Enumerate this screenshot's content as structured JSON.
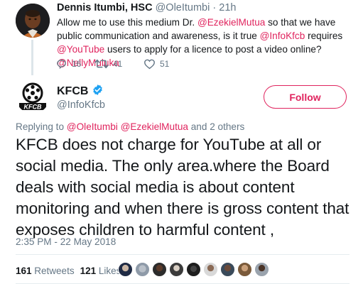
{
  "reply_tweet": {
    "author_name": "Dennis Itumbi, HSC",
    "author_handle": "@OleItumbi",
    "separator": "·",
    "time": "21h",
    "body_parts": [
      {
        "text": "Allow me to use this medium Dr. ",
        "link": false
      },
      {
        "text": "@EzekielMutua",
        "link": true
      },
      {
        "text": " so that we have public communication and awareness, is it true ",
        "link": false
      },
      {
        "text": "@InfoKfcb",
        "link": true
      },
      {
        "text": " requires ",
        "link": false
      },
      {
        "text": "@YouTube",
        "link": true
      },
      {
        "text": " users to apply for a licence to post a video online? ",
        "link": false
      },
      {
        "text": "@NellyMuluka",
        "link": true
      }
    ],
    "actions": {
      "reply_count": "16",
      "retweet_count": "41",
      "like_count": "51"
    }
  },
  "main_tweet": {
    "author_name": "KFCB",
    "author_handle": "@InfoKfcb",
    "logo_text": "KFCB",
    "follow_label": "Follow",
    "replying_prefix": "Replying to ",
    "replying_to_1": "@OleItumbi",
    "replying_to_2": "@EzekielMutua",
    "replying_suffix": " and 2 others",
    "text": "KFCB does not charge for YouTube at all or social media. The only area.where the Board deals with social media is about content monitoring and when there is gross content that exposes children to harmful content ,",
    "timestamp": "2:35 PM - 22 May 2018",
    "retweets_count": "161",
    "retweets_label": "Retweets",
    "likes_count": "121",
    "likes_label": "Likes"
  },
  "colors": {
    "accent": "#e0245e",
    "verified": "#1da1f2",
    "secondary_text": "#657786",
    "primary_text": "#14171a",
    "divider": "#e6ecf0"
  },
  "icons": [
    "reply-icon",
    "retweet-icon",
    "like-icon",
    "verified-badge-icon",
    "kfcb-logo-icon"
  ]
}
